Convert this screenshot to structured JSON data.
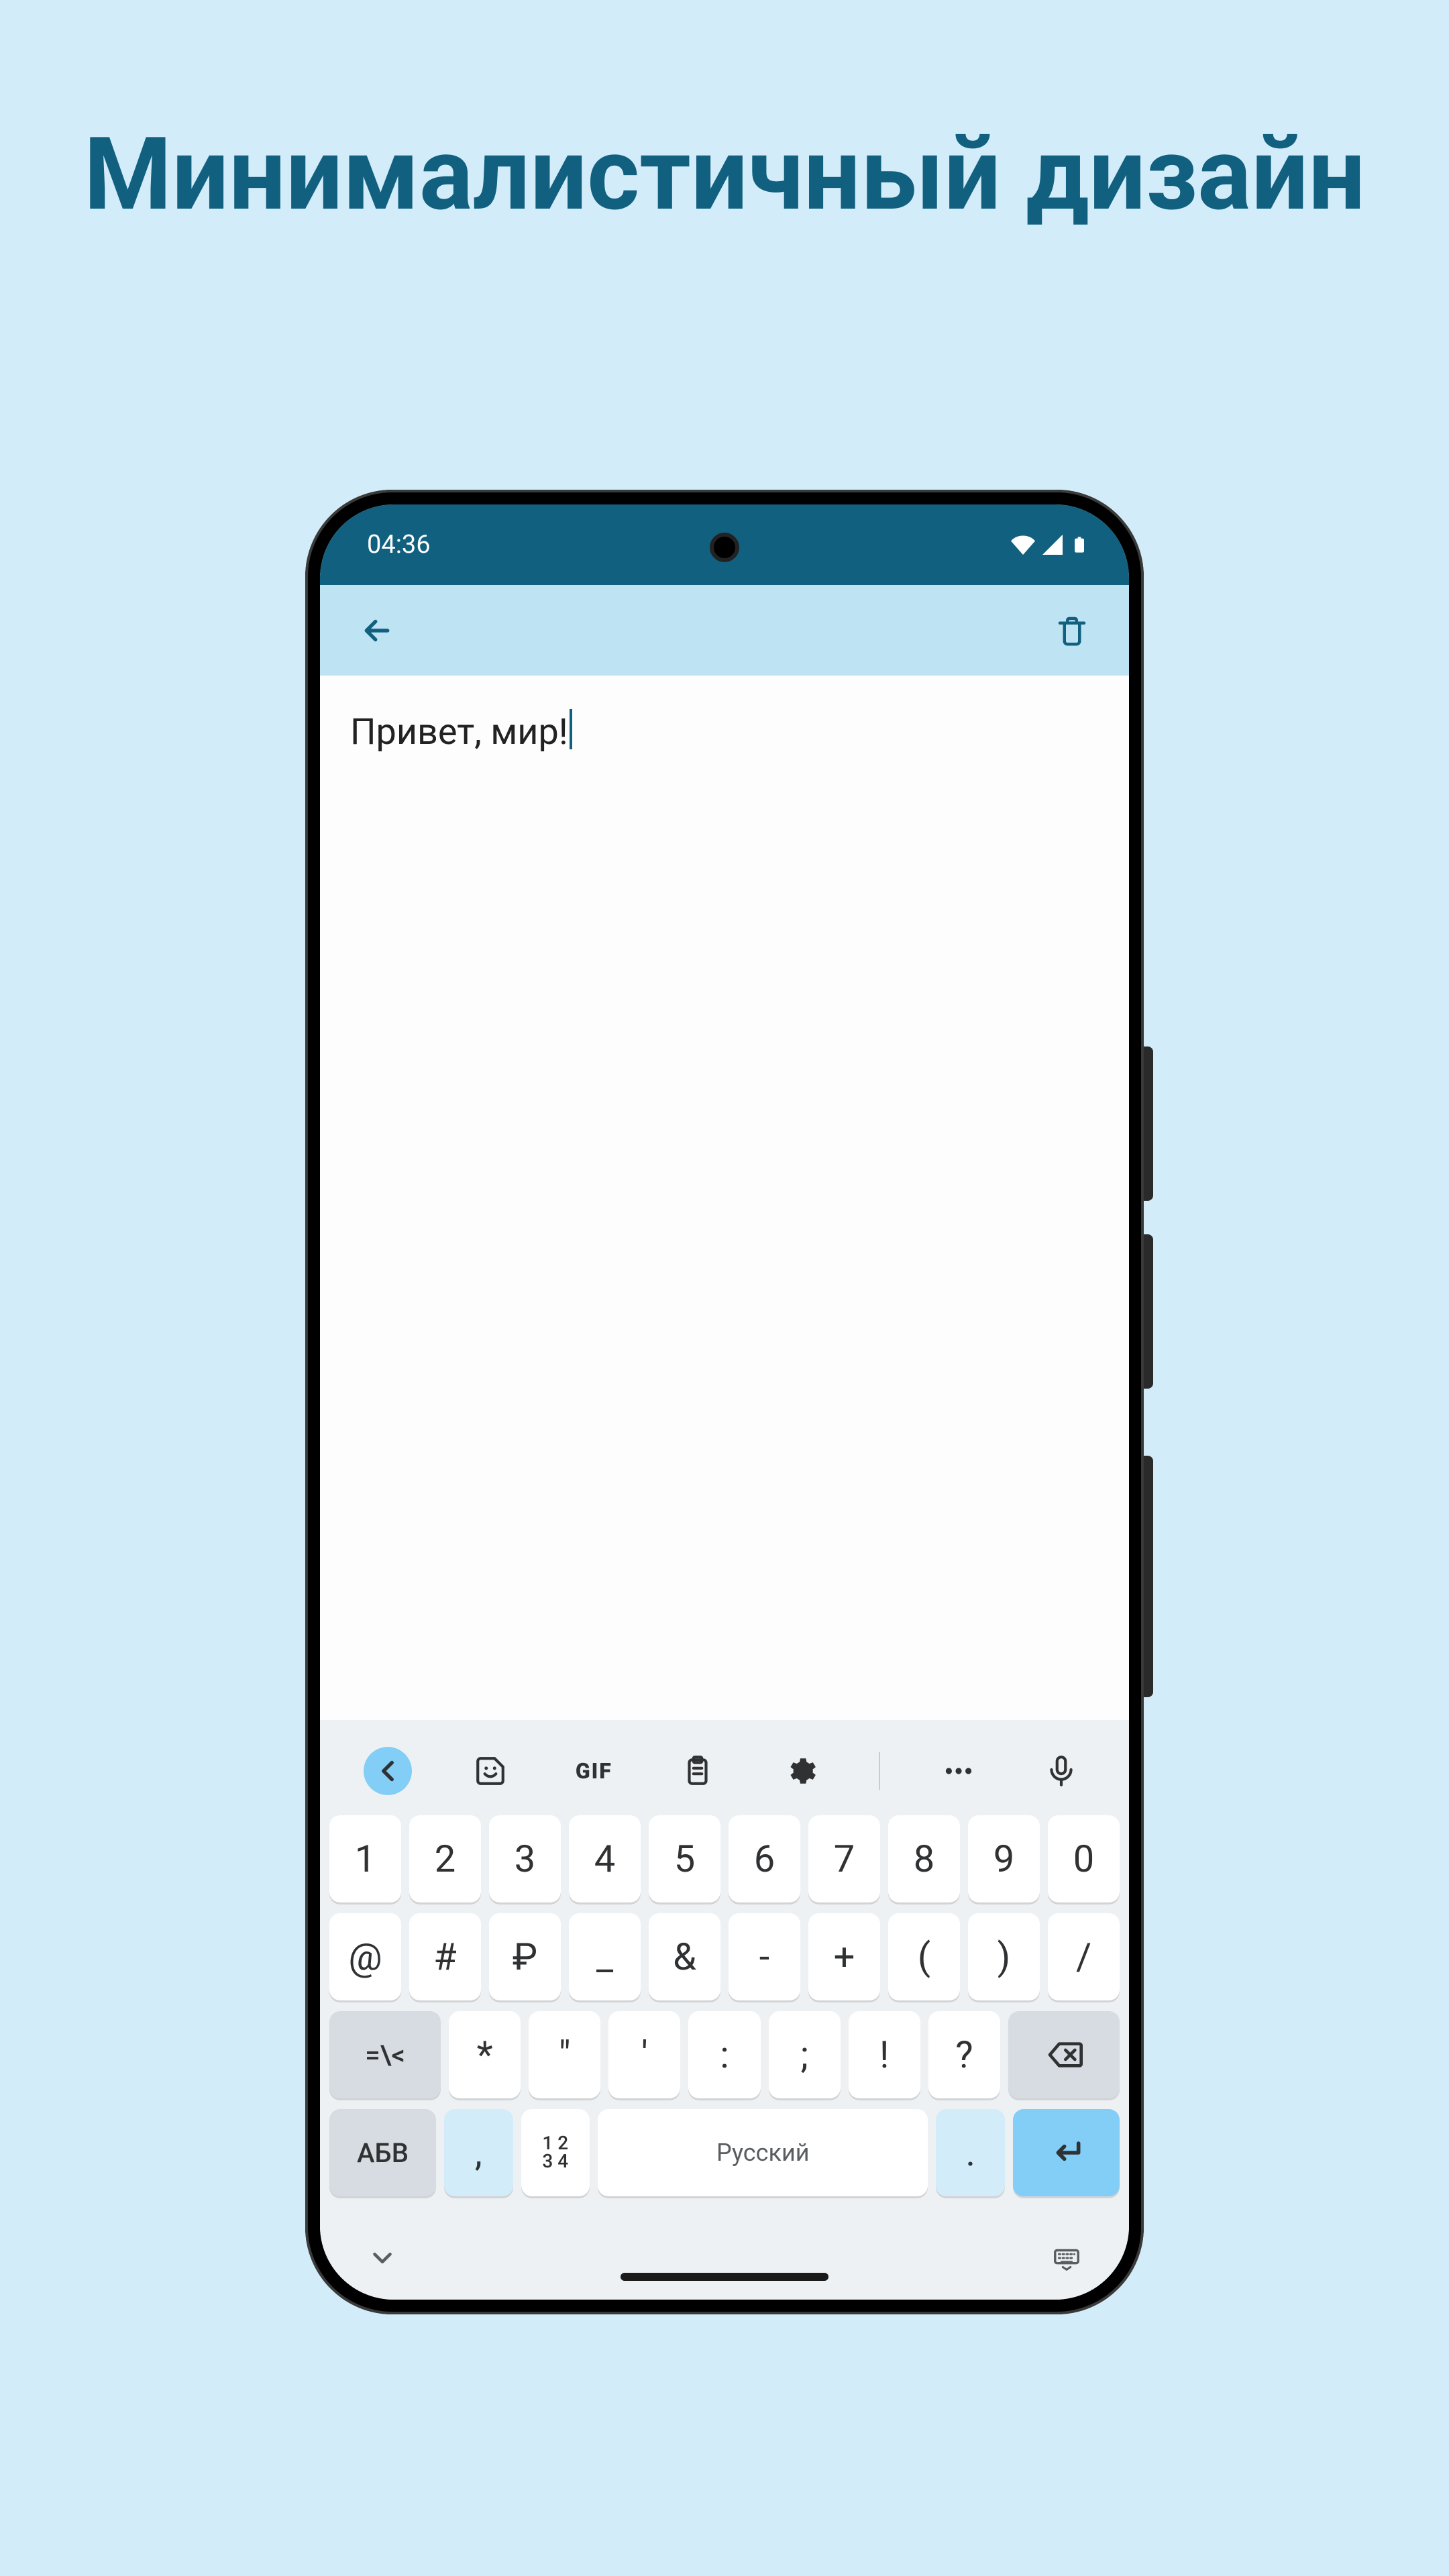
{
  "promo": {
    "heading": "Минималистичный дизайн"
  },
  "status": {
    "time": "04:36"
  },
  "appbar": {
    "back_icon": "arrow-back",
    "delete_icon": "trash"
  },
  "editor": {
    "text": "Привет, мир!"
  },
  "keyboard": {
    "toolbar": {
      "back": "chevron-left",
      "sticker": "sticker",
      "gif": "GIF",
      "clipboard": "clipboard",
      "settings": "gear",
      "more": "ellipsis",
      "mic": "microphone"
    },
    "rows": {
      "r1": [
        "1",
        "2",
        "3",
        "4",
        "5",
        "6",
        "7",
        "8",
        "9",
        "0"
      ],
      "r2": [
        "@",
        "#",
        "₽",
        "_",
        "&",
        "-",
        "+",
        "(",
        ")",
        "/"
      ],
      "r3_fn": "=\\<",
      "r3": [
        "*",
        "\"",
        "'",
        ":",
        ";",
        "!",
        "?"
      ],
      "r3_bksp": "backspace",
      "r4_mode": "АБВ",
      "r4_comma": ",",
      "r4_numstack_top": "1 2",
      "r4_numstack_bot": "3 4",
      "r4_space": "Русский",
      "r4_period": ".",
      "r4_enter": "enter"
    }
  },
  "colors": {
    "bg": "#d2ecf9",
    "brand_dark": "#11607f",
    "appbar_bg": "#bee3f3",
    "kb_bg": "#eef1f3",
    "accent": "#82cef6"
  }
}
